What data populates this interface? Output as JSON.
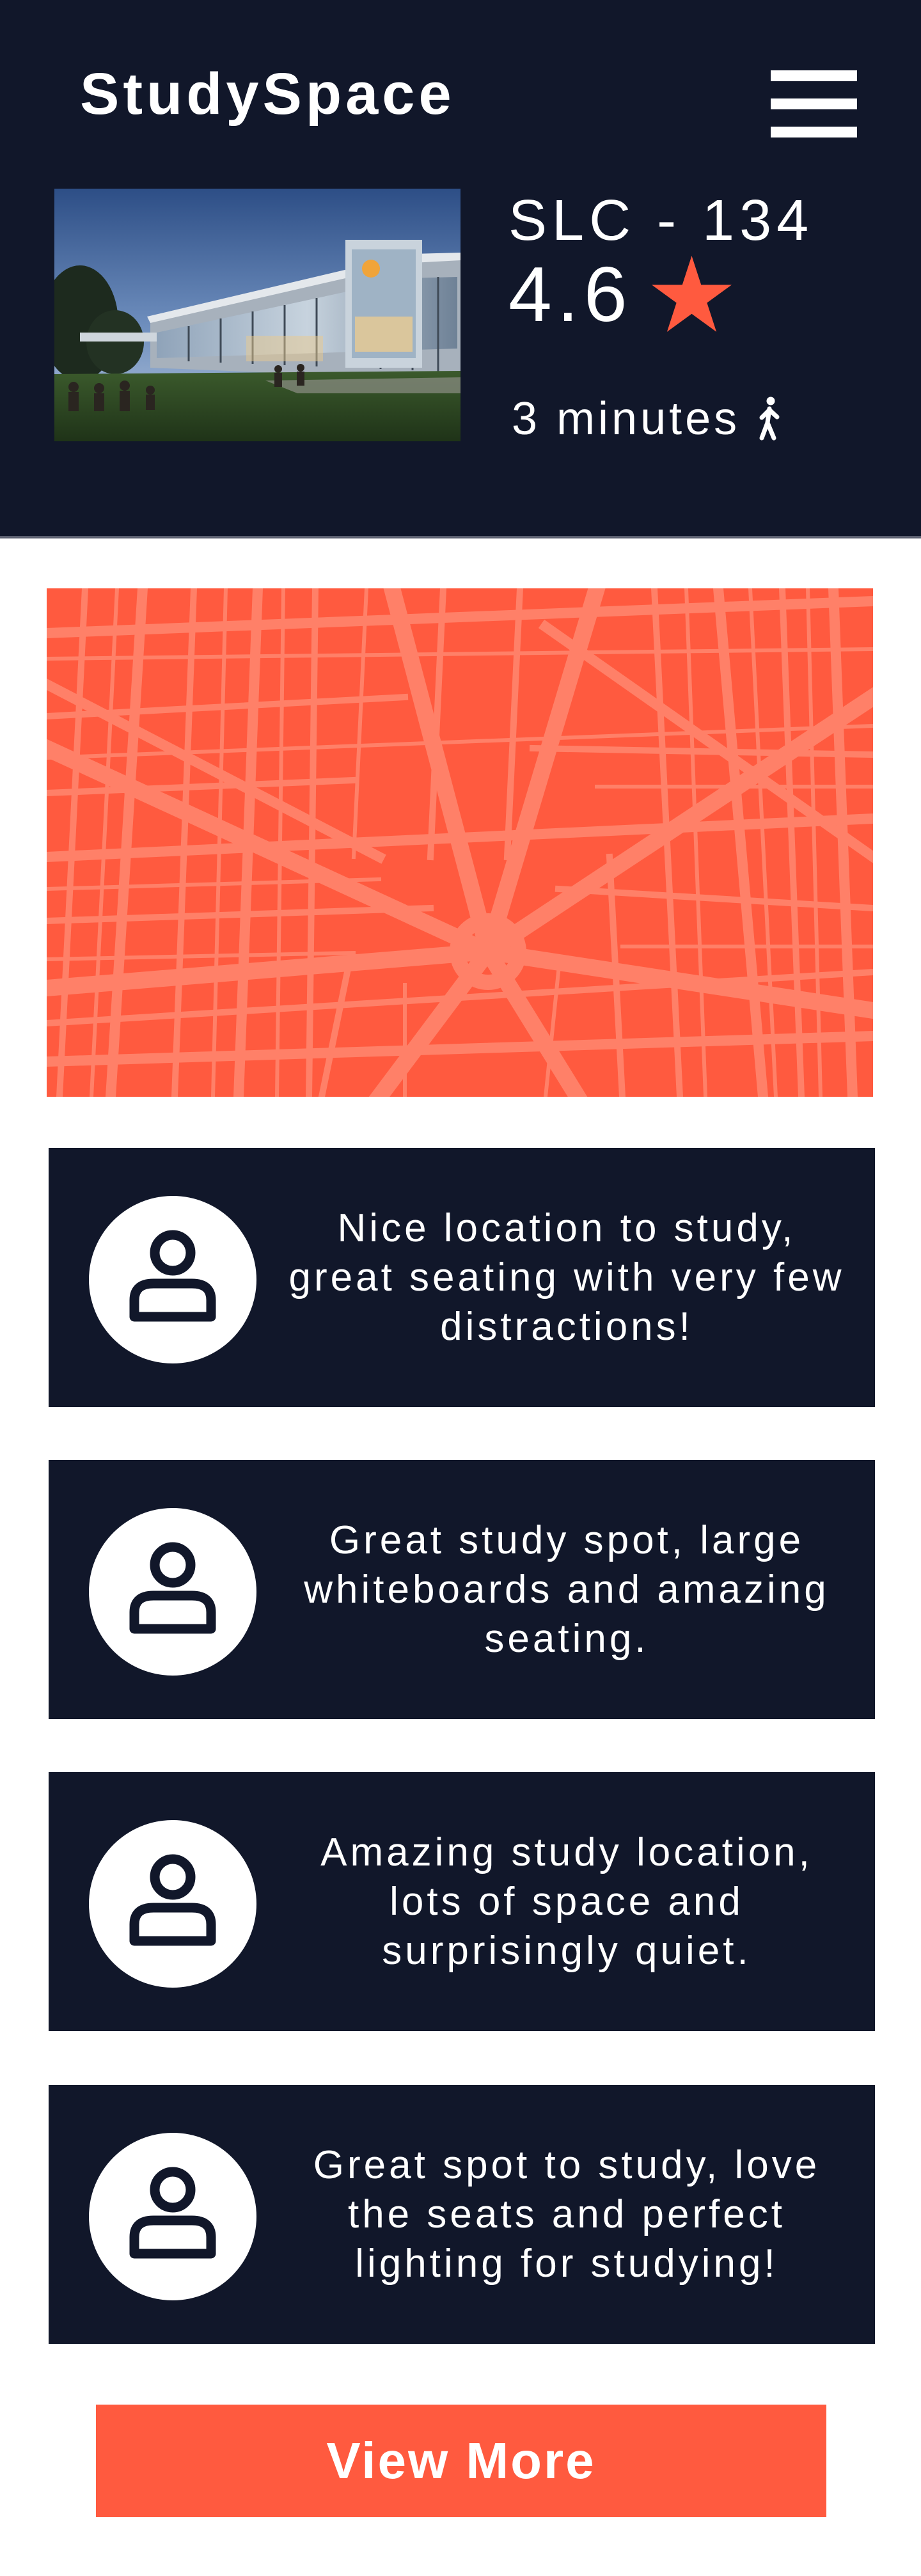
{
  "header": {
    "app_title": "StudySpace",
    "menu_icon": "hamburger-menu-icon"
  },
  "location": {
    "room": "SLC - 134",
    "rating": "4.6",
    "rating_icon": "star-icon",
    "walk_time": "3 minutes",
    "walk_icon": "walking-person-icon"
  },
  "map": {
    "icon": "city-map"
  },
  "reviews": [
    {
      "avatar_icon": "user-icon",
      "text": "Nice location to study, great seating with very few distractions!"
    },
    {
      "avatar_icon": "user-icon",
      "text": "Great study spot, large whiteboards and amazing seating."
    },
    {
      "avatar_icon": "user-icon",
      "text": "Amazing study location, lots of space and surprisingly quiet."
    },
    {
      "avatar_icon": "user-icon",
      "text": "Great spot to study, love the seats and perfect lighting for studying!"
    }
  ],
  "actions": {
    "view_more_label": "View More"
  },
  "colors": {
    "navy": "#11172a",
    "accent": "#ff5a3f",
    "white": "#ffffff"
  }
}
